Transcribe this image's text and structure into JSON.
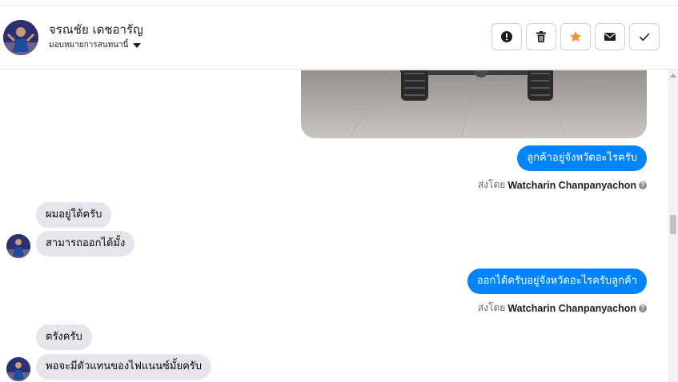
{
  "header": {
    "contact_name": "จรณชัย เดชอารัญ",
    "assign_label": "มอบหมายการสนทนานี้",
    "actions": [
      {
        "name": "spam-button",
        "icon": "alert-circle-icon"
      },
      {
        "name": "delete-button",
        "icon": "trash-icon"
      },
      {
        "name": "star-button",
        "icon": "star-icon",
        "color": "#f5923e"
      },
      {
        "name": "mark-unread-button",
        "icon": "envelope-icon"
      },
      {
        "name": "done-button",
        "icon": "checkmark-icon"
      }
    ]
  },
  "messages": [
    {
      "type": "image",
      "direction": "out",
      "description": "photo attachment"
    },
    {
      "type": "text",
      "direction": "out",
      "text": "ลูกค้าอยู่จังหวัดอะไรครับ"
    },
    {
      "type": "sent_by",
      "prefix": "ส่งโดย",
      "sender": "Watcharin Chanpanyachon"
    },
    {
      "type": "text",
      "direction": "in",
      "text": "ผมอยู่ใต้ครับ"
    },
    {
      "type": "text",
      "direction": "in",
      "text": "สามารถออกได้มั้ง"
    },
    {
      "type": "text",
      "direction": "out",
      "text": "ออกได้ครับอยู่จังหวัดอะไรครับลูกค้า"
    },
    {
      "type": "sent_by",
      "prefix": "ส่งโดย",
      "sender": "Watcharin Chanpanyachon"
    },
    {
      "type": "text",
      "direction": "in",
      "text": "ตรังครับ"
    },
    {
      "type": "text",
      "direction": "in",
      "text": "พอจะมีตัวแทนของไฟแนนซ์มั้ยครับ"
    }
  ],
  "colors": {
    "outgoing_bubble": "#0084ff",
    "incoming_bubble": "#e4e6eb",
    "star_accent": "#f5923e"
  }
}
